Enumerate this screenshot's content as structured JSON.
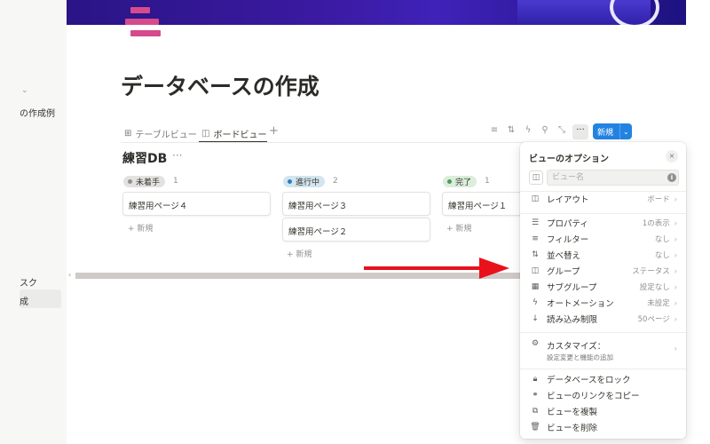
{
  "sidebar": {
    "caret": "⌄",
    "items": [
      {
        "label": "の作成例"
      },
      {
        "label": "スク"
      },
      {
        "label": "成"
      }
    ]
  },
  "page": {
    "title": "データベースの作成"
  },
  "views": {
    "tabs": [
      {
        "label": "テーブルビュー",
        "icon": "table-icon"
      },
      {
        "label": "ボードビュー",
        "icon": "board-icon",
        "active": true
      }
    ],
    "add_view": "+"
  },
  "toolbar": {
    "icons": [
      "filter-icon",
      "sort-icon",
      "automation-icon",
      "search-icon",
      "expand-icon"
    ],
    "more_label": "···",
    "new_label": "新規",
    "new_caret": "⌄"
  },
  "database": {
    "title": "練習DB",
    "more": "···"
  },
  "board": {
    "new_label": "+ 新規",
    "columns": [
      {
        "status": "未着手",
        "count": "1",
        "pill_bg": "#e3e2e0",
        "dot": "#91918e",
        "cards": [
          "練習用ページ４"
        ]
      },
      {
        "status": "進行中",
        "count": "2",
        "pill_bg": "#d3e5ef",
        "dot": "#2e7dbb",
        "cards": [
          "練習用ページ３",
          "練習用ページ２"
        ]
      },
      {
        "status": "完了",
        "count": "1",
        "pill_bg": "#dbeddb",
        "dot": "#4a9b5a",
        "cards": [
          "練習用ページ１"
        ]
      }
    ]
  },
  "popover": {
    "title": "ビューのオプション",
    "close": "×",
    "name_placeholder": "ビュー名",
    "info": "i",
    "options": [
      {
        "icon": "board-icon",
        "glyph": "◫",
        "label": "レイアウト",
        "value": "ボード"
      },
      {
        "icon": "properties-icon",
        "glyph": "☰",
        "label": "プロパティ",
        "value": "1の表示"
      },
      {
        "icon": "filter-icon",
        "glyph": "≡",
        "label": "フィルター",
        "value": "なし"
      },
      {
        "icon": "sort-icon",
        "glyph": "⇅",
        "label": "並べ替え",
        "value": "なし"
      },
      {
        "icon": "group-icon",
        "glyph": "◫",
        "label": "グループ",
        "value": "ステータス"
      },
      {
        "icon": "subgroup-icon",
        "glyph": "▦",
        "label": "サブグループ",
        "value": "設定なし"
      },
      {
        "icon": "automation-icon",
        "glyph": "ϟ",
        "label": "オートメーション",
        "value": "未設定"
      },
      {
        "icon": "load-limit-icon",
        "glyph": "↓",
        "label": "読み込み制限",
        "value": "50ページ"
      }
    ],
    "customize": {
      "icon": "gear-icon",
      "glyph": "⚙",
      "label": "カスタマイズ：",
      "sub": "設定変更と機能の追加"
    },
    "actions": [
      {
        "icon": "lock-icon",
        "glyph": "🔒︎",
        "label": "データベースをロック"
      },
      {
        "icon": "link-icon",
        "glyph": "⚭",
        "label": "ビューのリンクをコピー"
      },
      {
        "icon": "duplicate-icon",
        "glyph": "⧉",
        "label": "ビューを複製"
      },
      {
        "icon": "trash-icon",
        "glyph": "🗑︎",
        "label": "ビューを削除"
      }
    ],
    "chevron": "›"
  },
  "colors": {
    "accent": "#2383e2",
    "arrow": "#e8111c",
    "cover": "#2a1486",
    "page_icon": "#d64b8c"
  }
}
